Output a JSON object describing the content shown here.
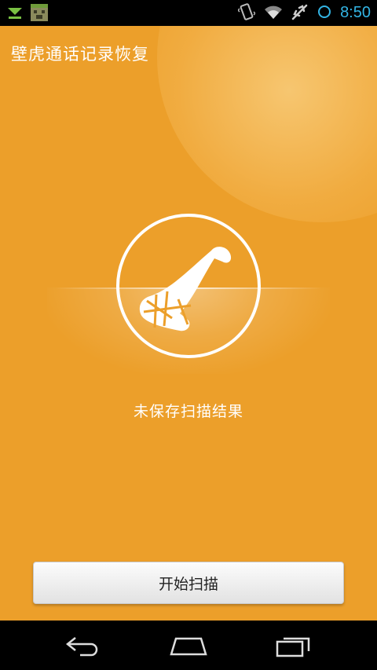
{
  "status_bar": {
    "time": "8:50",
    "left_icons": [
      "download-icon",
      "android-app-icon"
    ],
    "right_icons": [
      "vibrate-icon",
      "wifi-icon",
      "airplane-mode-icon",
      "sync-icon"
    ],
    "time_color": "#33b5e5"
  },
  "app": {
    "title": "壁虎通话记录恢复",
    "background_color": "#ec9f2a",
    "status_text": "未保存扫描结果",
    "scan_button_label": "开始扫描",
    "center_icon": "phone-handset-icon"
  },
  "nav_bar": {
    "buttons": [
      "back-icon",
      "home-icon",
      "recent-apps-icon"
    ]
  }
}
